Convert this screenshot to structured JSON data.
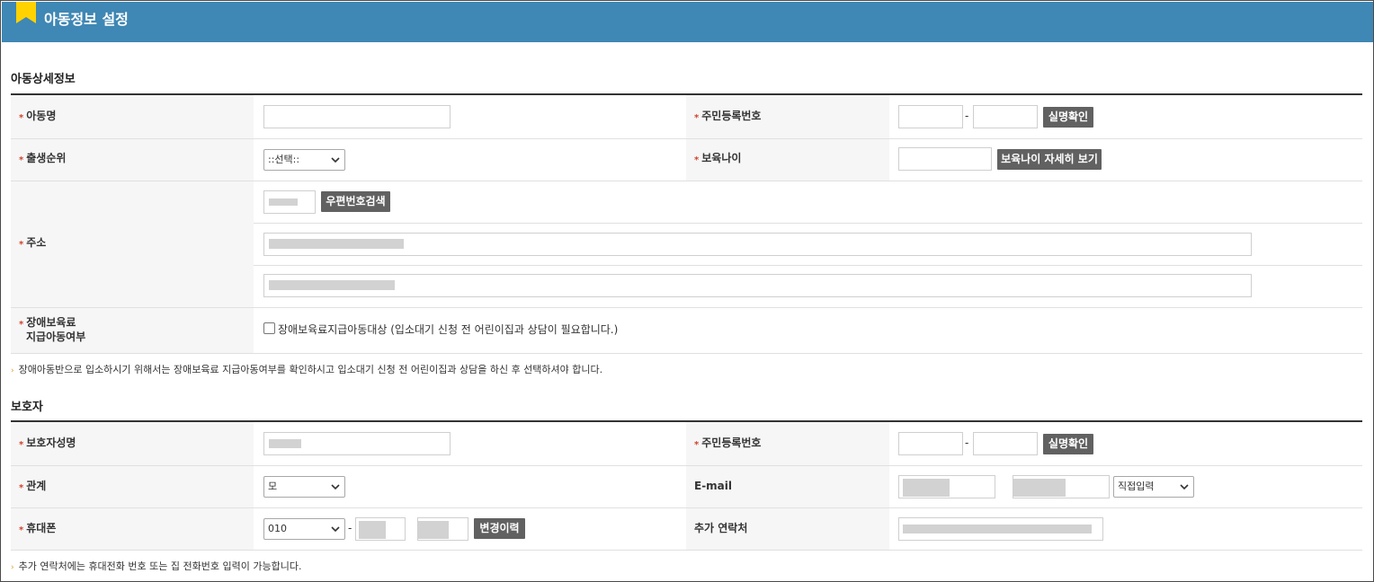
{
  "header": {
    "title": "아동정보 설정"
  },
  "child_section": {
    "title": "아동상세정보",
    "name_label": "아동명",
    "rrn_label": "주민등록번호",
    "verify_btn": "실명확인",
    "birth_order_label": "출생순위",
    "birth_order_value": "::선택::",
    "care_age_label": "보육나이",
    "care_age_btn": "보육나이 자세히 보기",
    "address_label": "주소",
    "zip_btn": "우편번호검색",
    "disability_label_1": "장애보육료",
    "disability_label_2": "지급아동여부",
    "disability_checkbox": "장애보육료지급아동대상 (입소대기 신청 전 어린이집과 상담이 필요합니다.)",
    "note": "장애아동반으로 입소하시기 위해서는 장애보육료 지급아동여부를 확인하시고 입소대기 신청 전 어린이집과 상담을 하신 후 선택하셔야 합니다."
  },
  "guardian_section": {
    "title": "보호자",
    "name_label": "보호자성명",
    "rrn_label": "주민등록번호",
    "verify_btn": "실명확인",
    "relation_label": "관계",
    "relation_value": "모",
    "email_label": "E-mail",
    "email_domain_select": "직접입력",
    "phone_label": "휴대폰",
    "phone_prefix": "010",
    "phone_history_btn": "변경이력",
    "extra_contact_label": "추가 연락처",
    "note": "추가 연락처에는 휴대전화 번호 또는 집 전화번호 입력이 가능합니다."
  },
  "symbols": {
    "dash": "-",
    "required": "*"
  },
  "colors": {
    "header": "#3f87b4",
    "required": "#d2422c",
    "button": "#616161"
  }
}
